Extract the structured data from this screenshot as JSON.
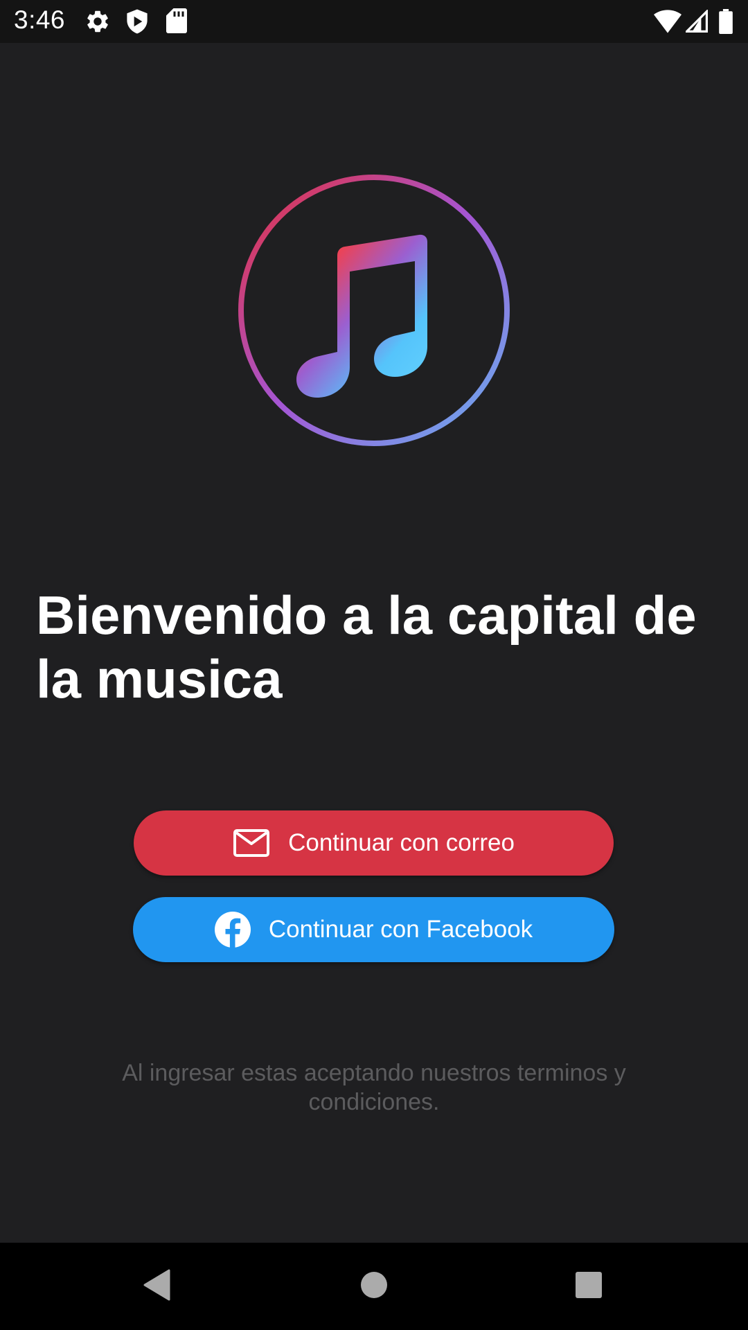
{
  "status_bar": {
    "time": "3:46",
    "left_icons": [
      "settings-icon",
      "shield-play-icon",
      "sd-card-icon"
    ],
    "right_icons": [
      "wifi-icon",
      "signal-icon",
      "battery-icon"
    ]
  },
  "logo": {
    "icon": "music-note-icon",
    "ring_colors": [
      "#d8314a",
      "#9f56d6",
      "#6aa8f0"
    ]
  },
  "welcome": {
    "title": "Bienvenido a la capital de la musica"
  },
  "buttons": {
    "email": {
      "label": "Continuar con correo",
      "icon": "mail-icon",
      "color": "#d63444"
    },
    "facebook": {
      "label": "Continuar con Facebook",
      "icon": "facebook-icon",
      "color": "#2196f0"
    }
  },
  "terms": {
    "text": "Al ingresar estas aceptando nuestros terminos y condiciones."
  },
  "nav_bar": {
    "buttons": [
      "back-icon",
      "home-icon",
      "recents-icon"
    ]
  }
}
